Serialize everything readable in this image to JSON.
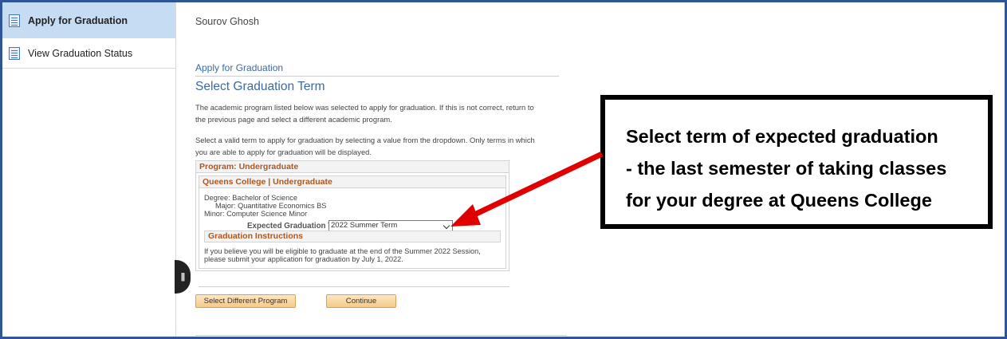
{
  "sidebar": {
    "items": [
      {
        "label": "Apply for Graduation",
        "icon": "document-icon",
        "active": true
      },
      {
        "label": "View Graduation Status",
        "icon": "document-icon",
        "active": false
      }
    ]
  },
  "header": {
    "user_name": "Sourov Ghosh"
  },
  "main": {
    "breadcrumb": "Apply for Graduation",
    "title": "Select Graduation Term",
    "intro_paragraph": "The academic program listed below was selected to apply for graduation. If this is not correct, return to the previous page and select a different academic program.",
    "term_paragraph": "Select a valid term to apply for graduation by selecting a value from the dropdown. Only terms in which you are able to apply for graduation will be displayed.",
    "program_header": "Program: Undergraduate",
    "institution_header": "Queens College | Undergraduate",
    "degree": "Degree: Bachelor of Science",
    "major": "Major: Quantitative Economics BS",
    "minor": "Minor: Computer Science Minor",
    "expected_term_label": "Expected Graduation Term",
    "expected_term_value": "2022 Summer Term",
    "instructions_header": "Graduation Instructions",
    "instructions_text": "If you believe you will be eligible to graduate at the end of the Summer 2022 Session, please submit your application for graduation by July 1, 2022.",
    "select_program_button": "Select Different Program",
    "continue_button": "Continue"
  },
  "callout": {
    "line1": "Select term of expected graduation",
    "line2": "- the last semester of taking classes",
    "line3": "for your degree at Queens College"
  },
  "colors": {
    "frame_border": "#2f5597",
    "active_sidebar": "#c6dcf3",
    "heading_blue": "#3c6aa5",
    "section_orange": "#b0561f",
    "arrow_red": "#e00000"
  }
}
